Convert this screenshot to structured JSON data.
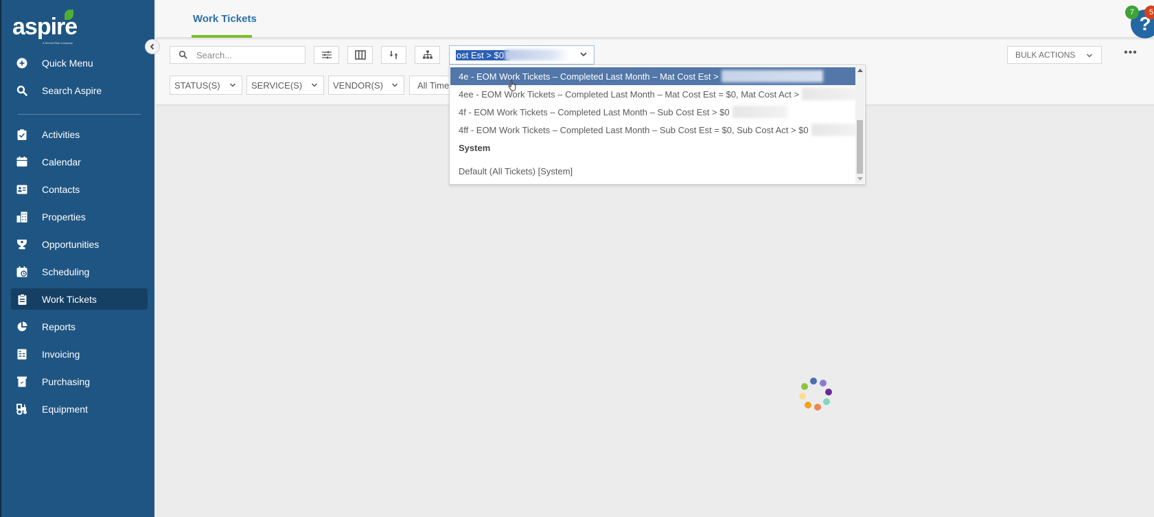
{
  "brand": {
    "name": "aspire",
    "tagline": "A ServiceTitan Company",
    "leaf_color": "#4fae33"
  },
  "sidebar": {
    "top_items": [
      {
        "label": "Quick Menu",
        "icon": "plus-circle-icon"
      },
      {
        "label": "Search Aspire",
        "icon": "search-icon"
      }
    ],
    "items": [
      {
        "label": "Activities",
        "icon": "clipboard-check-icon"
      },
      {
        "label": "Calendar",
        "icon": "calendar-icon"
      },
      {
        "label": "Contacts",
        "icon": "address-card-icon"
      },
      {
        "label": "Properties",
        "icon": "building-icon"
      },
      {
        "label": "Opportunities",
        "icon": "trophy-icon"
      },
      {
        "label": "Scheduling",
        "icon": "calendar-clock-icon"
      },
      {
        "label": "Work Tickets",
        "icon": "clipboard-list-icon",
        "active": true
      },
      {
        "label": "Reports",
        "icon": "pie-chart-icon"
      },
      {
        "label": "Invoicing",
        "icon": "invoice-icon"
      },
      {
        "label": "Purchasing",
        "icon": "receipt-icon"
      },
      {
        "label": "Equipment",
        "icon": "tractor-icon"
      }
    ],
    "collapse_icon": "chevron-left-icon"
  },
  "header": {
    "tab": "Work Tickets",
    "help": {
      "icon": "question-icon",
      "badge_green": "7",
      "badge_red": "5"
    }
  },
  "toolbar": {
    "search_placeholder": "Search...",
    "buttons": [
      "sliders-icon",
      "columns-icon",
      "sort-icon",
      "hierarchy-icon"
    ],
    "view_select": {
      "value": "ost Est > $0 ["
    },
    "bulk_actions": "BULK ACTIONS",
    "more": "•••"
  },
  "filters": [
    {
      "label": "STATUS(S)"
    },
    {
      "label": "SERVICE(S)"
    },
    {
      "label": "VENDOR(S)"
    },
    {
      "label": "All Time"
    }
  ],
  "dropdown": {
    "options": [
      {
        "label": "4e - EOM Work Tickets – Completed Last Month – Mat Cost Est >",
        "highlighted": true
      },
      {
        "label": "4ee - EOM Work Tickets – Completed Last Month – Mat Cost Est = $0, Mat Cost Act >"
      },
      {
        "label": "4f - EOM Work Tickets – Completed Last Month – Sub Cost Est > $0"
      },
      {
        "label": "4ff - EOM Work Tickets – Completed Last Month – Sub Cost Est = $0, Sub Cost Act > $0"
      }
    ],
    "group_label": "System",
    "system_option": "Default (All Tickets) [System]"
  },
  "loading": {
    "spinner_colors": [
      "#4b6fb0",
      "#8a7bd0",
      "#6a2a9a",
      "#7ed8c2",
      "#ee8455",
      "#f2a31c",
      "#f7e08e",
      "#8cc540"
    ]
  }
}
